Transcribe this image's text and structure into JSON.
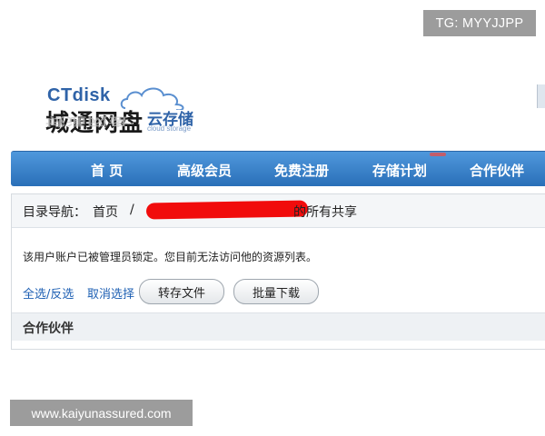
{
  "watermark_top": "TG: MYYJJPP",
  "watermark_bottom": "www.kaiyunassured.com",
  "logo": {
    "brand_en": "CTdisk",
    "brand_cn": "城通网盘",
    "tagline_cn": "云存储",
    "tagline_en": "cloud storage"
  },
  "nav": {
    "items": [
      "首 页",
      "高级会员",
      "免费注册",
      "存储计划",
      "合作伙伴"
    ]
  },
  "breadcrumb": {
    "label": "目录导航：",
    "home": "首页",
    "separator": "/",
    "suffix": "的所有共享"
  },
  "message": "该用户账户已被管理员锁定。您目前无法访问他的资源列表。",
  "actions": {
    "select_all": "全选/反选",
    "cancel_select": "取消选择",
    "save_files": "转存文件",
    "batch_download": "批量下载"
  },
  "partners": {
    "title": "合作伙伴"
  },
  "colors": {
    "nav_top": "#4f98dc",
    "nav_bottom": "#2a6fb8",
    "link": "#1d5fb3",
    "redaction": "#f10c0c"
  }
}
